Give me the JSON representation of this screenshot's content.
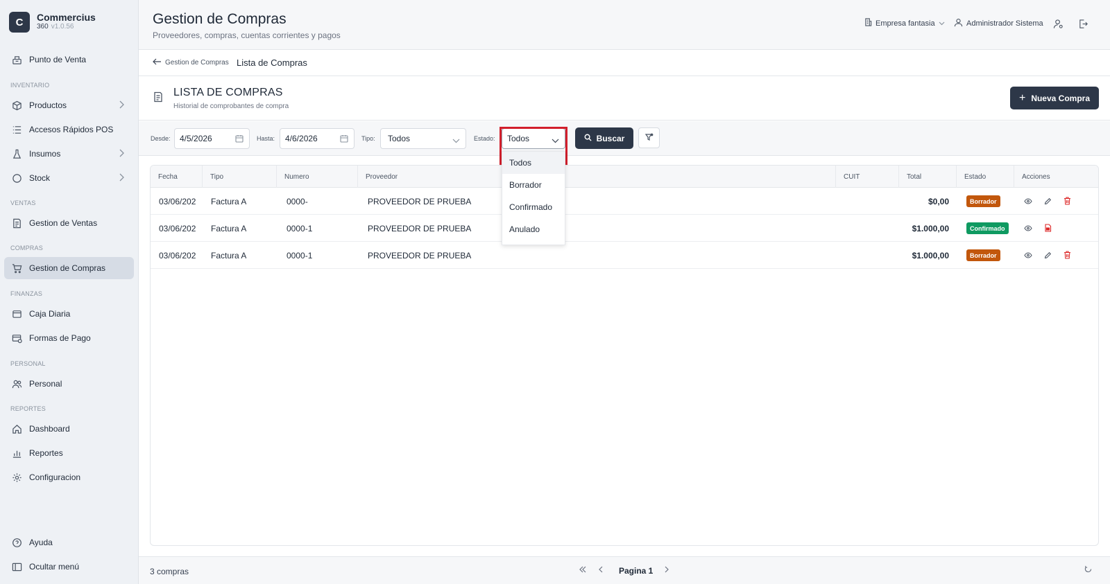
{
  "brand": {
    "letter": "C",
    "name": "Commercius",
    "sub": "360",
    "version": "v1.0.56"
  },
  "sidebar": {
    "items": [
      {
        "label": "Punto de Venta"
      },
      {
        "section": "INVENTARIO"
      },
      {
        "label": "Productos"
      },
      {
        "label": "Accesos Rápidos POS"
      },
      {
        "label": "Insumos"
      },
      {
        "label": "Stock"
      },
      {
        "section": "VENTAS"
      },
      {
        "label": "Gestion de Ventas"
      },
      {
        "section": "COMPRAS"
      },
      {
        "label": "Gestion de Compras"
      },
      {
        "section": "FINANZAS"
      },
      {
        "label": "Caja Diaria"
      },
      {
        "label": "Formas de Pago"
      },
      {
        "section": "PERSONAL"
      },
      {
        "label": "Personal"
      },
      {
        "section": "REPORTES"
      },
      {
        "label": "Dashboard"
      },
      {
        "label": "Reportes"
      },
      {
        "label": "Configuracion"
      }
    ],
    "help": "Ayuda",
    "hide_menu": "Ocultar menú"
  },
  "header": {
    "title": "Gestion de Compras",
    "subtitle": "Proveedores, compras, cuentas corrientes y pagos",
    "company": "Empresa fantasia",
    "user": "Administrador Sistema"
  },
  "breadcrumb": {
    "back": "Gestion de Compras",
    "current": "Lista de Compras"
  },
  "page": {
    "title": "LISTA DE COMPRAS",
    "subtitle": "Historial de comprobantes de compra",
    "new_button": "Nueva Compra"
  },
  "filters": {
    "desde_label": "Desde:",
    "desde_value": "4/5/2026",
    "hasta_label": "Hasta:",
    "hasta_value": "4/6/2026",
    "tipo_label": "Tipo:",
    "tipo_value": "Todos",
    "estado_label": "Estado:",
    "estado_value": "Todos",
    "search_button": "Buscar",
    "estado_options": [
      "Todos",
      "Borrador",
      "Confirmado",
      "Anulado"
    ]
  },
  "table": {
    "columns": [
      "Fecha",
      "Tipo",
      "Numero",
      "Proveedor",
      "CUIT",
      "Total",
      "Estado",
      "Acciones"
    ],
    "rows": [
      {
        "fecha": "03/06/202",
        "tipo": "Factura A",
        "numero": "0000-",
        "proveedor": "PROVEEDOR DE PRUEBA",
        "cuit": "",
        "total": "$0,00",
        "estado": "Borrador"
      },
      {
        "fecha": "03/06/202",
        "tipo": "Factura A",
        "numero": "0000-1",
        "proveedor": "PROVEEDOR DE PRUEBA",
        "cuit": "",
        "total": "$1.000,00",
        "estado": "Confirmado"
      },
      {
        "fecha": "03/06/202",
        "tipo": "Factura A",
        "numero": "0000-1",
        "proveedor": "PROVEEDOR DE PRUEBA",
        "cuit": "",
        "total": "$1.000,00",
        "estado": "Borrador"
      }
    ]
  },
  "footer": {
    "count": "3 compras",
    "page": "Pagina 1"
  },
  "colors": {
    "primary": "#2d3748",
    "borrador": "#c2570c",
    "confirmado": "#0f9a61",
    "highlight": "#d21f2c",
    "danger": "#dc2626"
  }
}
